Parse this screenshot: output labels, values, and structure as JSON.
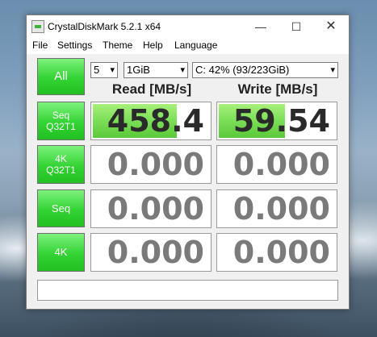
{
  "window": {
    "title": "CrystalDiskMark 5.2.1 x64",
    "min_glyph": "—",
    "max_glyph": "☐",
    "close_glyph": "✕"
  },
  "menu": [
    "File",
    "Settings",
    "Theme",
    "Help",
    "Language"
  ],
  "controls": {
    "all_label": "All",
    "test_count": "5",
    "test_size": "1GiB",
    "drive": "C: 42% (93/223GiB)",
    "dropdown_arrow": "▾"
  },
  "headers": {
    "read": "Read [MB/s]",
    "write": "Write [MB/s]"
  },
  "tests": [
    {
      "line1": "Seq",
      "line2": "Q32T1",
      "read": "458.4",
      "write": "59.54",
      "read_fill_pct": 72,
      "write_fill_pct": 57
    },
    {
      "line1": "4K",
      "line2": "Q32T1",
      "read": "0.000",
      "write": "0.000",
      "read_fill_pct": 0,
      "write_fill_pct": 0
    },
    {
      "line1": "Seq",
      "line2": "",
      "read": "0.000",
      "write": "0.000",
      "read_fill_pct": 0,
      "write_fill_pct": 0
    },
    {
      "line1": "4K",
      "line2": "",
      "read": "0.000",
      "write": "0.000",
      "read_fill_pct": 0,
      "write_fill_pct": 0
    }
  ],
  "comment": "",
  "colors": {
    "button_green": "#33d333",
    "bar_green": "#7ee05a"
  }
}
